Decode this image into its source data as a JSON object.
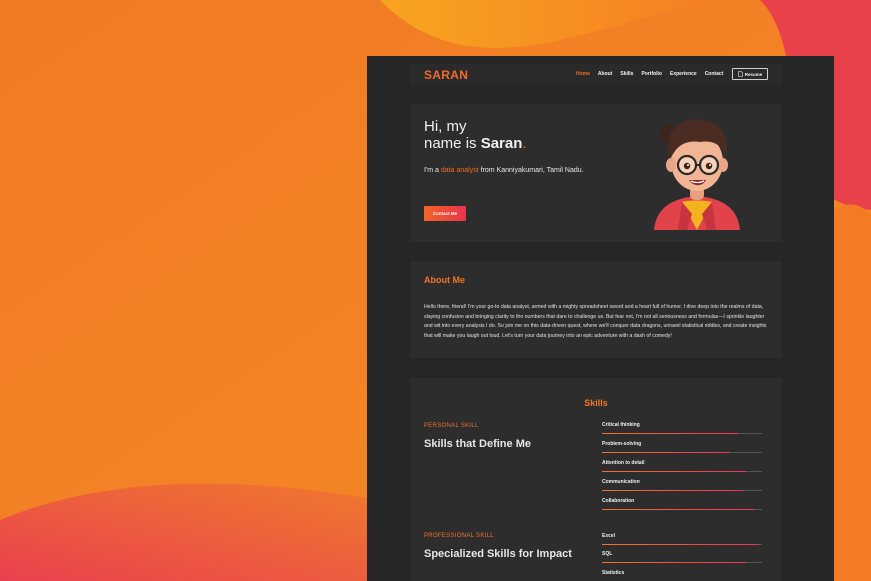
{
  "colors": {
    "accent": "#f26a2a",
    "accent2": "#e8344a",
    "page_bg": "#262626",
    "card_bg": "#2d2d2d"
  },
  "nav": {
    "logo": "SARAN",
    "links": [
      "Home",
      "About",
      "Skills",
      "Portfolio",
      "Experience",
      "Contact"
    ],
    "active": "Home",
    "resume_label": "Resume",
    "resume_icon": "document-icon"
  },
  "hero": {
    "greeting": "Hi, my",
    "name_prefix": "name is ",
    "name": "Saran",
    "name_suffix": ".",
    "sub_prefix": "I'm a ",
    "sub_highlight": "data analyst",
    "sub_suffix": " from Kanniyakumari, Tamil Nadu.",
    "contact_label": "Contact Me"
  },
  "about": {
    "title": "About Me",
    "text": "Hello there, friend! I'm your go-to data analyst, armed with a mighty spreadsheet sword and a heart full of humor. I dive deep into the realms of data, slaying confusion and bringing clarity to the numbers that dare to challenge us. But fear not, I'm not all seriousness and formulas—I sprinkle laughter and wit into every analysis I do. So join me on this data-driven quest, where we'll conquer data dragons, unravel statistical riddles, and create insights that will make you laugh out loud. Let's turn your data journey into an epic adventure with a dash of comedy!"
  },
  "skills": {
    "title": "Skills",
    "personal": {
      "label": "PERSONAL SKILL",
      "heading": "Skills that Define Me",
      "items": [
        {
          "name": "Critical thinking",
          "level": 0.85
        },
        {
          "name": "Problem-solving",
          "level": 0.8
        },
        {
          "name": "Attention to detail",
          "level": 0.9
        },
        {
          "name": "Communication",
          "level": 0.88
        },
        {
          "name": "Collaboration",
          "level": 0.95
        }
      ]
    },
    "professional": {
      "label": "PROFESSIONAL SKILL",
      "heading": "Specialized Skills for Impact",
      "items": [
        {
          "name": "Excel",
          "level": 0.98
        },
        {
          "name": "SQL",
          "level": 0.9
        },
        {
          "name": "Statistics",
          "level": 0.85
        }
      ]
    }
  }
}
